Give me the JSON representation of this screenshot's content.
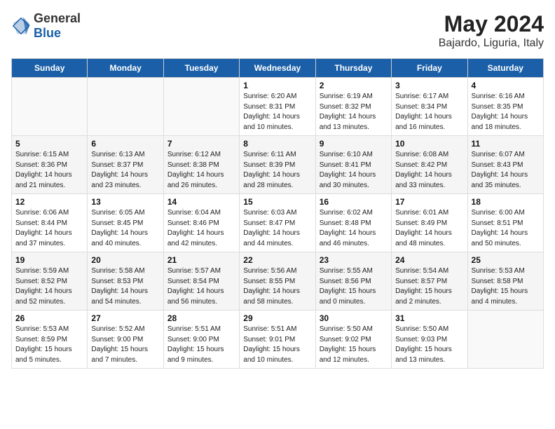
{
  "header": {
    "logo": {
      "general": "General",
      "blue": "Blue"
    },
    "title": "May 2024",
    "location": "Bajardo, Liguria, Italy"
  },
  "calendar": {
    "weekdays": [
      "Sunday",
      "Monday",
      "Tuesday",
      "Wednesday",
      "Thursday",
      "Friday",
      "Saturday"
    ],
    "weeks": [
      [
        {
          "day": "",
          "info": ""
        },
        {
          "day": "",
          "info": ""
        },
        {
          "day": "",
          "info": ""
        },
        {
          "day": "1",
          "info": "Sunrise: 6:20 AM\nSunset: 8:31 PM\nDaylight: 14 hours\nand 10 minutes."
        },
        {
          "day": "2",
          "info": "Sunrise: 6:19 AM\nSunset: 8:32 PM\nDaylight: 14 hours\nand 13 minutes."
        },
        {
          "day": "3",
          "info": "Sunrise: 6:17 AM\nSunset: 8:34 PM\nDaylight: 14 hours\nand 16 minutes."
        },
        {
          "day": "4",
          "info": "Sunrise: 6:16 AM\nSunset: 8:35 PM\nDaylight: 14 hours\nand 18 minutes."
        }
      ],
      [
        {
          "day": "5",
          "info": "Sunrise: 6:15 AM\nSunset: 8:36 PM\nDaylight: 14 hours\nand 21 minutes."
        },
        {
          "day": "6",
          "info": "Sunrise: 6:13 AM\nSunset: 8:37 PM\nDaylight: 14 hours\nand 23 minutes."
        },
        {
          "day": "7",
          "info": "Sunrise: 6:12 AM\nSunset: 8:38 PM\nDaylight: 14 hours\nand 26 minutes."
        },
        {
          "day": "8",
          "info": "Sunrise: 6:11 AM\nSunset: 8:39 PM\nDaylight: 14 hours\nand 28 minutes."
        },
        {
          "day": "9",
          "info": "Sunrise: 6:10 AM\nSunset: 8:41 PM\nDaylight: 14 hours\nand 30 minutes."
        },
        {
          "day": "10",
          "info": "Sunrise: 6:08 AM\nSunset: 8:42 PM\nDaylight: 14 hours\nand 33 minutes."
        },
        {
          "day": "11",
          "info": "Sunrise: 6:07 AM\nSunset: 8:43 PM\nDaylight: 14 hours\nand 35 minutes."
        }
      ],
      [
        {
          "day": "12",
          "info": "Sunrise: 6:06 AM\nSunset: 8:44 PM\nDaylight: 14 hours\nand 37 minutes."
        },
        {
          "day": "13",
          "info": "Sunrise: 6:05 AM\nSunset: 8:45 PM\nDaylight: 14 hours\nand 40 minutes."
        },
        {
          "day": "14",
          "info": "Sunrise: 6:04 AM\nSunset: 8:46 PM\nDaylight: 14 hours\nand 42 minutes."
        },
        {
          "day": "15",
          "info": "Sunrise: 6:03 AM\nSunset: 8:47 PM\nDaylight: 14 hours\nand 44 minutes."
        },
        {
          "day": "16",
          "info": "Sunrise: 6:02 AM\nSunset: 8:48 PM\nDaylight: 14 hours\nand 46 minutes."
        },
        {
          "day": "17",
          "info": "Sunrise: 6:01 AM\nSunset: 8:49 PM\nDaylight: 14 hours\nand 48 minutes."
        },
        {
          "day": "18",
          "info": "Sunrise: 6:00 AM\nSunset: 8:51 PM\nDaylight: 14 hours\nand 50 minutes."
        }
      ],
      [
        {
          "day": "19",
          "info": "Sunrise: 5:59 AM\nSunset: 8:52 PM\nDaylight: 14 hours\nand 52 minutes."
        },
        {
          "day": "20",
          "info": "Sunrise: 5:58 AM\nSunset: 8:53 PM\nDaylight: 14 hours\nand 54 minutes."
        },
        {
          "day": "21",
          "info": "Sunrise: 5:57 AM\nSunset: 8:54 PM\nDaylight: 14 hours\nand 56 minutes."
        },
        {
          "day": "22",
          "info": "Sunrise: 5:56 AM\nSunset: 8:55 PM\nDaylight: 14 hours\nand 58 minutes."
        },
        {
          "day": "23",
          "info": "Sunrise: 5:55 AM\nSunset: 8:56 PM\nDaylight: 15 hours\nand 0 minutes."
        },
        {
          "day": "24",
          "info": "Sunrise: 5:54 AM\nSunset: 8:57 PM\nDaylight: 15 hours\nand 2 minutes."
        },
        {
          "day": "25",
          "info": "Sunrise: 5:53 AM\nSunset: 8:58 PM\nDaylight: 15 hours\nand 4 minutes."
        }
      ],
      [
        {
          "day": "26",
          "info": "Sunrise: 5:53 AM\nSunset: 8:59 PM\nDaylight: 15 hours\nand 5 minutes."
        },
        {
          "day": "27",
          "info": "Sunrise: 5:52 AM\nSunset: 9:00 PM\nDaylight: 15 hours\nand 7 minutes."
        },
        {
          "day": "28",
          "info": "Sunrise: 5:51 AM\nSunset: 9:00 PM\nDaylight: 15 hours\nand 9 minutes."
        },
        {
          "day": "29",
          "info": "Sunrise: 5:51 AM\nSunset: 9:01 PM\nDaylight: 15 hours\nand 10 minutes."
        },
        {
          "day": "30",
          "info": "Sunrise: 5:50 AM\nSunset: 9:02 PM\nDaylight: 15 hours\nand 12 minutes."
        },
        {
          "day": "31",
          "info": "Sunrise: 5:50 AM\nSunset: 9:03 PM\nDaylight: 15 hours\nand 13 minutes."
        },
        {
          "day": "",
          "info": ""
        }
      ]
    ]
  }
}
